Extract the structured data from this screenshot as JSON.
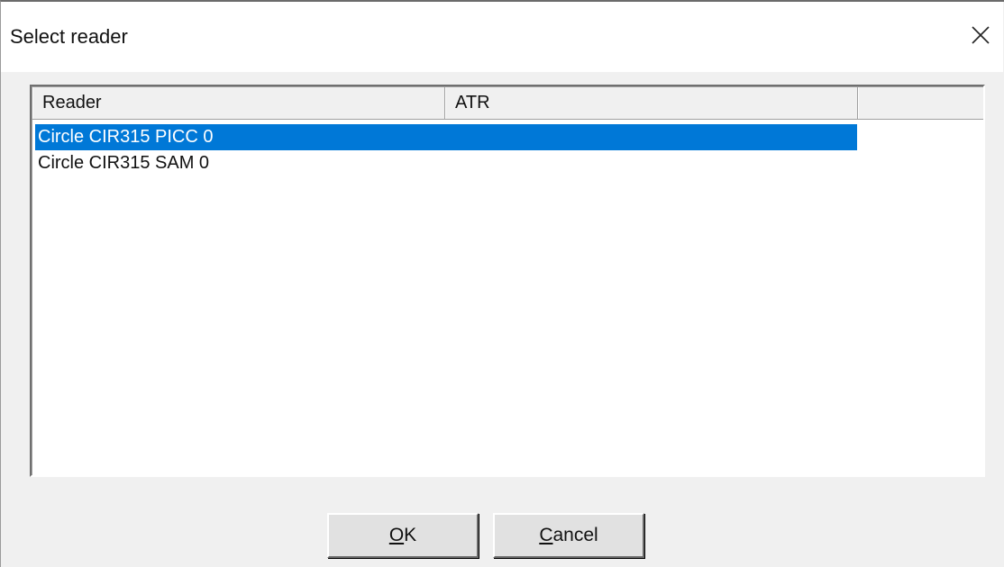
{
  "window": {
    "title": "Select reader",
    "close_icon": "close-icon"
  },
  "listview": {
    "columns": [
      "Reader",
      "ATR",
      ""
    ],
    "rows": [
      {
        "reader": "Circle CIR315 PICC 0",
        "atr": "",
        "selected": true
      },
      {
        "reader": "Circle CIR315 SAM 0",
        "atr": "",
        "selected": false
      }
    ]
  },
  "buttons": {
    "ok": {
      "mnemonic": "O",
      "rest": "K"
    },
    "cancel": {
      "mnemonic": "C",
      "rest": "ancel"
    }
  },
  "colors": {
    "selection": "#0078d7",
    "dialog_bg": "#f0f0f0"
  }
}
